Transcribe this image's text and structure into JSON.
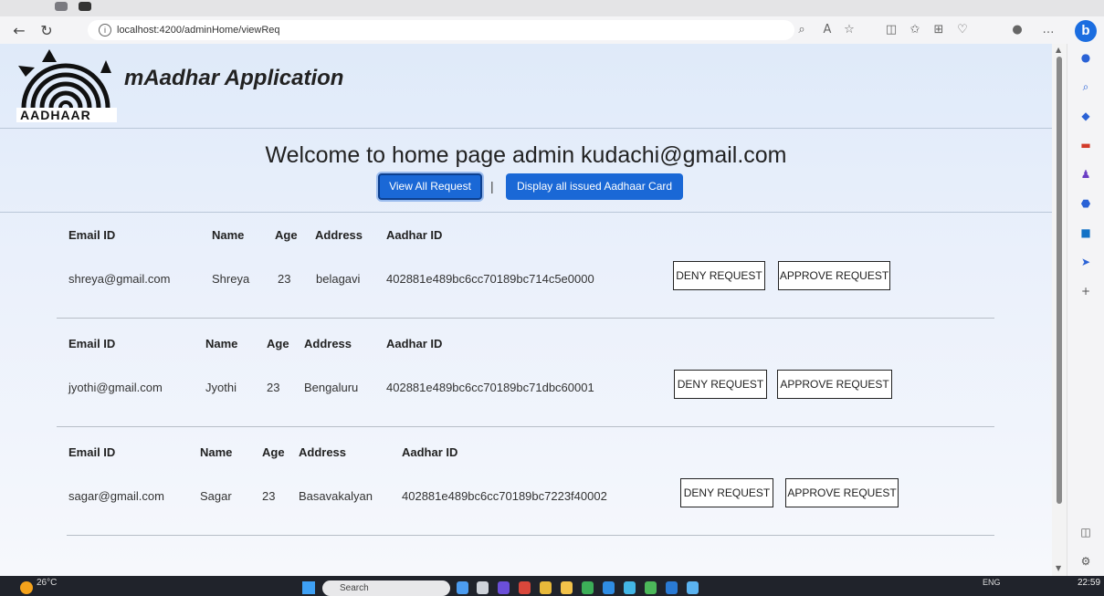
{
  "browser": {
    "url": "localhost:4200/adminHome/viewReq",
    "info_glyph": "i"
  },
  "header": {
    "logo_text": "AADHAAR",
    "app_title": "mAadhar Application"
  },
  "main": {
    "welcome": "Welcome to home page admin kudachi@gmail.com",
    "view_all_label": "View All Request",
    "separator": "|",
    "display_issued_label": "Display all issued Aadhaar Card"
  },
  "columns": {
    "email": "Email ID",
    "name": "Name",
    "age": "Age",
    "address": "Address",
    "aadhar": "Aadhar ID"
  },
  "requests": [
    {
      "email": "shreya@gmail.com",
      "name": "Shreya",
      "age": "23",
      "address": "belagavi",
      "aadhar": "402881e489bc6cc70189bc714c5e0000",
      "deny_label": "DENY REQUEST",
      "approve_label": "APPROVE REQUEST"
    },
    {
      "email": "jyothi@gmail.com",
      "name": "Jyothi",
      "age": "23",
      "address": "Bengaluru",
      "aadhar": "402881e489bc6cc70189bc71dbc60001",
      "deny_label": "DENY REQUEST",
      "approve_label": "APPROVE REQUEST"
    },
    {
      "email": "sagar@gmail.com",
      "name": "Sagar",
      "age": "23",
      "address": "Basavakalyan",
      "aadhar": "402881e489bc6cc70189bc7223f40002",
      "deny_label": "DENY REQUEST",
      "approve_label": "APPROVE REQUEST"
    }
  ],
  "taskbar": {
    "weather": "26°C",
    "search_placeholder": "Search",
    "language": "ENG",
    "time": "22:59"
  },
  "colors": {
    "primary_button": "#1a68d6",
    "page_gradient_top": "#dfeaf9",
    "taskbar": "#20232b"
  },
  "icons": [
    "back-icon",
    "refresh-icon",
    "info-icon",
    "read-aloud-icon",
    "favorite-icon",
    "split-screen-icon",
    "collections-icon",
    "extensions-icon",
    "profile-icon",
    "more-icon",
    "bing-copilot-icon",
    "bell-icon",
    "search-icon",
    "shopping-icon",
    "tools-icon",
    "games-icon",
    "office-icon",
    "outlook-icon",
    "send-icon",
    "add-icon",
    "sidebar-toggle-icon",
    "settings-icon"
  ]
}
